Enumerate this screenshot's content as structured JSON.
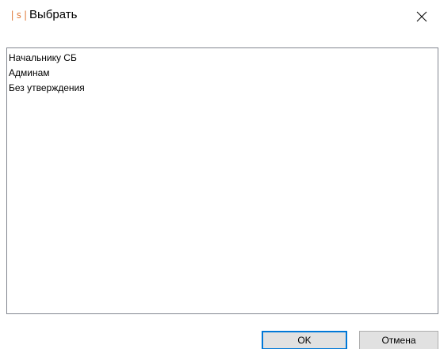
{
  "window": {
    "icon_text": "|s|",
    "title": "Выбрать"
  },
  "list": {
    "items": [
      {
        "label": "Начальнику СБ"
      },
      {
        "label": "Админам"
      },
      {
        "label": "Без утверждения"
      }
    ]
  },
  "buttons": {
    "ok_label": "OK",
    "cancel_label": "Отмена"
  },
  "colors": {
    "accent": "#0078d7",
    "icon": "#e07a3a",
    "border": "#828790"
  },
  "icons": {
    "close": "close-icon",
    "app": "app-logo-icon"
  }
}
